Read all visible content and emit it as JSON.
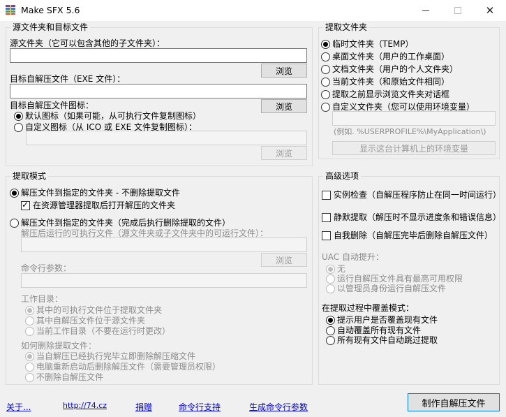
{
  "window": {
    "title": "Make SFX 5.6"
  },
  "source_group": {
    "legend": "源文件夹和目标文件",
    "source_label": "源文件夹（它可以包含其他的子文件夹）：",
    "source_value": "",
    "browse1": "浏览",
    "target_label": "目标自解压文件（EXE 文件）：",
    "target_value": "",
    "icon_label": "目标自解压文件图标：",
    "browse2": "浏览",
    "icon_default": "默认图标（如果可能，从可执行文件复制图标）",
    "icon_custom": "自定义图标（从 ICO 或 EXE 文件复制图标）：",
    "icon_value": "",
    "browse3": "浏览"
  },
  "extract_mode": {
    "legend": "提取模式",
    "opt1": "解压文件到指定的文件夹 - 不删除提取文件",
    "opt1_check": "在资源管理器提取后打开解压的文件夹",
    "opt2": "解压文件到指定的文件夹（完成后执行删除提取的文件）",
    "run_label": "解压后运行的可执行文件（源文件夹或子文件夹中的可运行文件）：",
    "run_value": "",
    "browse4": "浏览",
    "cmd_label": "命令行参数：",
    "cmd_value": "",
    "workdir_label": "工作目录：",
    "wd1": "其中的可执行文件位于提取文件夹",
    "wd2": "其中自解压文件位于源文件夹",
    "wd3": "当前工作目录（不要在运行时更改）",
    "del_label": "如何删除提取文件：",
    "del1": "当自解压已经执行完毕立即删除解压缩文件",
    "del2": "电脑重新启动后删除解压文件（需要管理员权限）",
    "del3": "不删除自解压文件"
  },
  "extract_folder": {
    "legend": "提取文件夹",
    "opts": [
      "临时文件夹（TEMP）",
      "桌面文件夹（用户的工作桌面）",
      "文档文件夹（用户的个人文件夹）",
      "当前文件夹（和原始文件相同）",
      "提取之前显示浏览文件夹对话框",
      "自定义文件夹（您可以使用环境变量）"
    ],
    "custom_value": "",
    "example": "(例如. %USERPROFILE%\\MyApplication\\)",
    "env_button": "显示这台计算机上的环境变量"
  },
  "advanced": {
    "legend": "高级选项",
    "chk1": "实例检查（自解压程序防止在同一时间运行）",
    "chk2": "静默提取（解压时不显示进度条和错误信息）",
    "chk3": "自我删除（自解压完毕后删除自解压文件）",
    "uac_label": "UAC 自动提升：",
    "uac1": "无",
    "uac2": "运行自解压文件具有最高可用权限",
    "uac3": "以管理员身份运行自解压文件",
    "overwrite_label": "在提取过程中覆盖模式：",
    "ow1": "提示用户是否覆盖现有文件",
    "ow2": "自动覆盖所有现有文件",
    "ow3": "所有现有文件自动跳过提取"
  },
  "footer": {
    "about": "关于...",
    "site": "http://74.cz",
    "donate": "捐赠",
    "cmd_support": "命令行支持",
    "gen_cmd": "生成命令行参数",
    "make": "制作自解压文件"
  }
}
